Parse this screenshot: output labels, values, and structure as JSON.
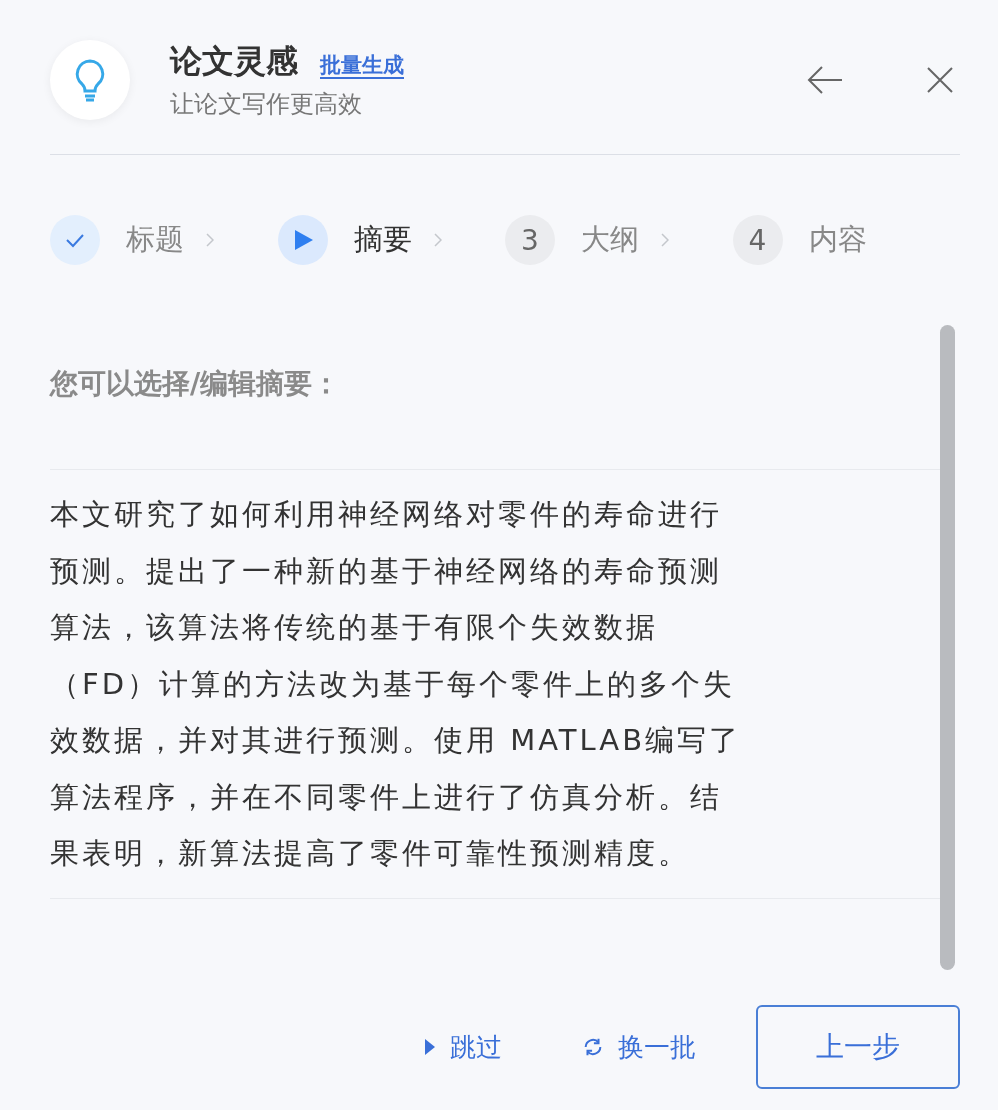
{
  "header": {
    "title": "论文灵感",
    "link": "批量生成",
    "subtitle": "让论文写作更高效"
  },
  "steps": [
    {
      "label": "标题",
      "done": true,
      "selected": false
    },
    {
      "label": "摘要",
      "done": false,
      "selected": true
    },
    {
      "label": "大纲",
      "done": false,
      "selected": false,
      "number": "3"
    },
    {
      "label": "内容",
      "done": false,
      "selected": false,
      "number": "4"
    }
  ],
  "prompt": "您可以选择/编辑摘要：",
  "abstract": "本文研究了如何利用神经网络对零件的寿命进行预测。提出了一种新的基于神经网络的寿命预测算法，该算法将传统的基于有限个失效数据（FD）计算的方法改为基于每个零件上的多个失效数据，并对其进行预测。使用 MATLAB编写了算法程序，并在不同零件上进行了仿真分析。结果表明，新算法提高了零件可靠性预测精度。",
  "actions": [
    {
      "kind": "skip",
      "label": "跳过"
    },
    {
      "kind": "refresh",
      "label": "换一批"
    },
    {
      "kind": "outlined",
      "label": "上一步"
    }
  ]
}
